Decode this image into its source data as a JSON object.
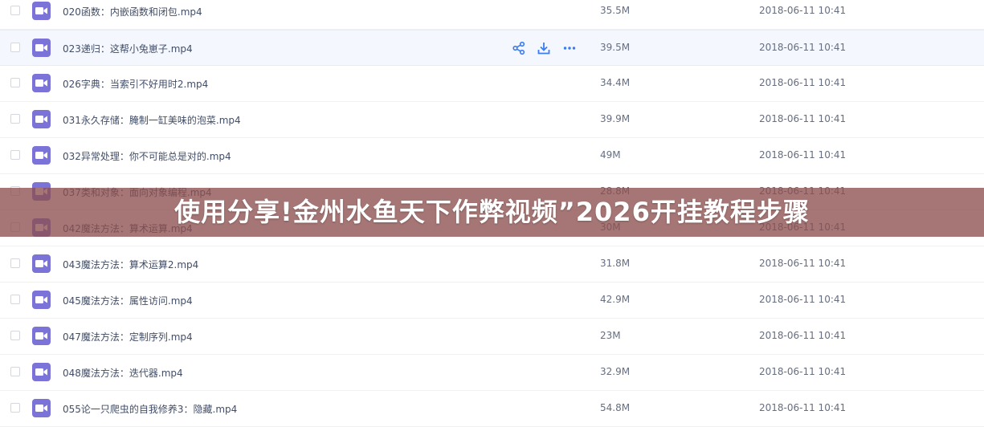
{
  "files": [
    {
      "name": "020函数：内嵌函数和闭包.mp4",
      "size": "35.5M",
      "date": "2018-06-11 10:41"
    },
    {
      "name": "023递归：这帮小兔崽子.mp4",
      "size": "39.5M",
      "date": "2018-06-11 10:41"
    },
    {
      "name": "026字典：当索引不好用时2.mp4",
      "size": "34.4M",
      "date": "2018-06-11 10:41"
    },
    {
      "name": "031永久存储：腌制一缸美味的泡菜.mp4",
      "size": "39.9M",
      "date": "2018-06-11 10:41"
    },
    {
      "name": "032异常处理：你不可能总是对的.mp4",
      "size": "49M",
      "date": "2018-06-11 10:41"
    },
    {
      "name": "037类和对象：面向对象编程.mp4",
      "size": "28.8M",
      "date": "2018-06-11 10:41"
    },
    {
      "name": "042魔法方法：算术运算.mp4",
      "size": "30M",
      "date": "2018-06-11 10:41"
    },
    {
      "name": "043魔法方法：算术运算2.mp4",
      "size": "31.8M",
      "date": "2018-06-11 10:41"
    },
    {
      "name": "045魔法方法：属性访问.mp4",
      "size": "42.9M",
      "date": "2018-06-11 10:41"
    },
    {
      "name": "047魔法方法：定制序列.mp4",
      "size": "23M",
      "date": "2018-06-11 10:41"
    },
    {
      "name": "048魔法方法：迭代器.mp4",
      "size": "32.9M",
      "date": "2018-06-11 10:41"
    },
    {
      "name": "055论一只爬虫的自我修养3：隐藏.mp4",
      "size": "54.8M",
      "date": "2018-06-11 10:41"
    }
  ],
  "hover_row_index": 1,
  "row_actions": {
    "icons": [
      "share-icon",
      "download-icon",
      "more-icon"
    ]
  },
  "overlay": {
    "title": "使用分享!金州水鱼天下作弊视频”2026开挂教程步骤"
  },
  "colors": {
    "file_icon": "#7c73d8",
    "hover_bg": "#f4f8fe",
    "action_icon": "#3b7cf0",
    "overlay_bg": "#8c504e"
  }
}
